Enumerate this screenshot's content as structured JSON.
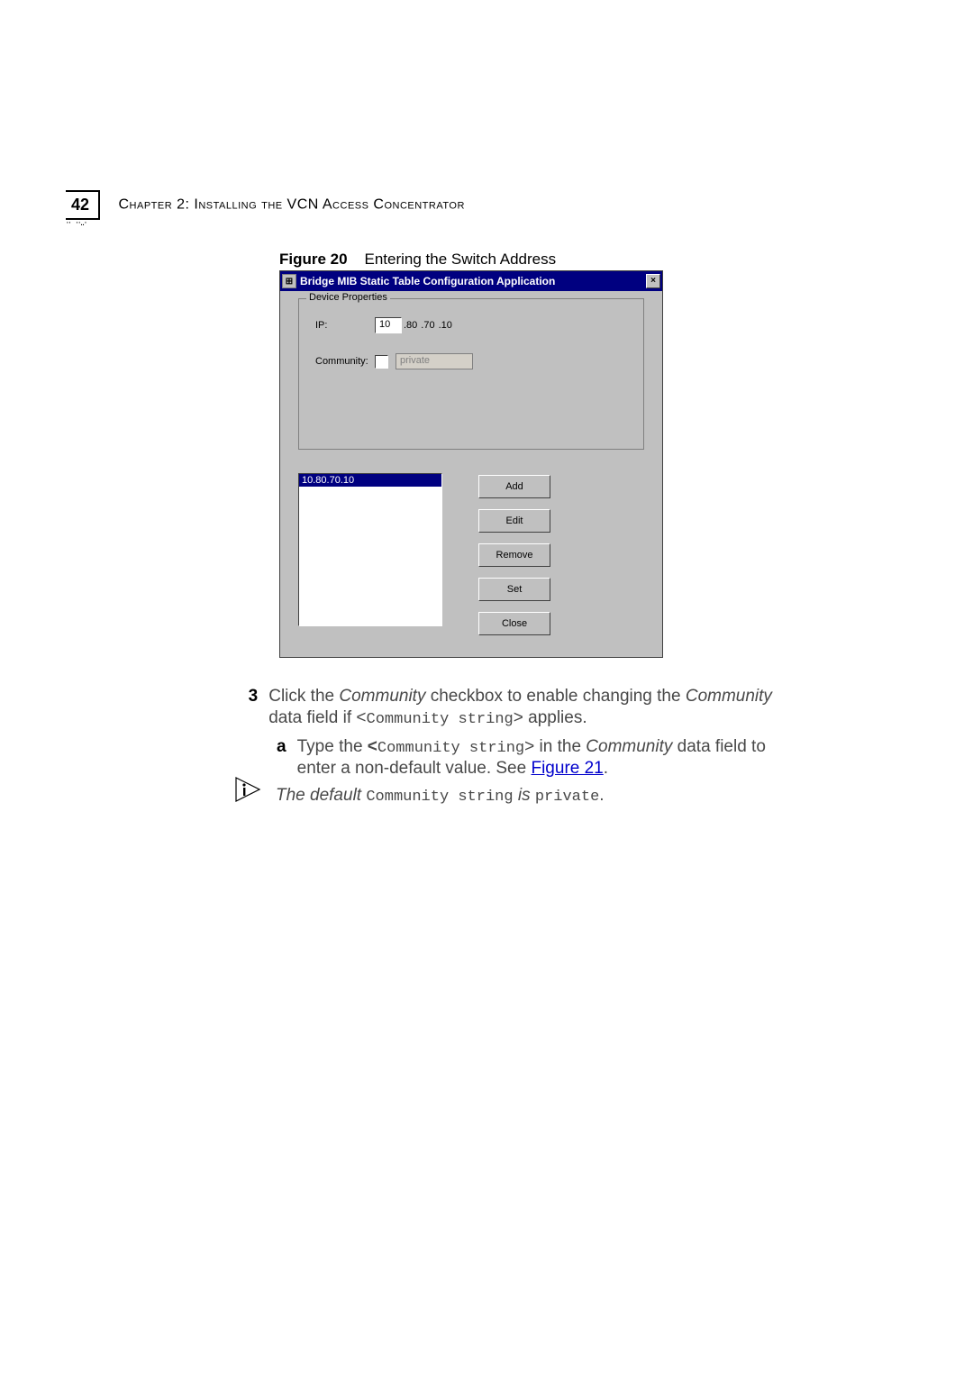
{
  "header": {
    "page_number": "42",
    "chapter_label": "Chapter 2: Installing the VCN Access Concentrator"
  },
  "figure_caption": {
    "label": "Figure 20",
    "text": "Entering the Switch Address"
  },
  "dialog": {
    "title": "Bridge MIB Static Table Configuration Application",
    "close_glyph": "×",
    "device_properties_legend": "Device Properties",
    "ip_label": "IP:",
    "ip_octets": [
      "10",
      ".80",
      ".70",
      ".10"
    ],
    "community_label": "Community:",
    "community_placeholder": "private",
    "list_selected": "10.80.70.10",
    "buttons": {
      "add": "Add",
      "edit": "Edit",
      "remove": "Remove",
      "set": "Set",
      "close": "Close"
    }
  },
  "body": {
    "step3_num": "3",
    "step3_text_a": "Click the ",
    "step3_em1": "Community",
    "step3_text_b": " checkbox to enable changing the ",
    "step3_em2": "Community",
    "step3_text_c": " data field if <",
    "step3_mono1": "Community string",
    "step3_text_d": "> applies.",
    "stepa_num": "a",
    "stepa_text_a": "Type the ",
    "stepa_bold_open": "<",
    "stepa_mono1": "Community string",
    "stepa_bold_close": ">",
    "stepa_text_b": " in the ",
    "stepa_em1": "Community",
    "stepa_text_c": " data field to enter a non-default value. See ",
    "stepa_link": "Figure 21",
    "default_a": "The default ",
    "default_mono1": "Community string",
    "default_b": " is ",
    "default_mono2": "private",
    "default_c": "."
  }
}
